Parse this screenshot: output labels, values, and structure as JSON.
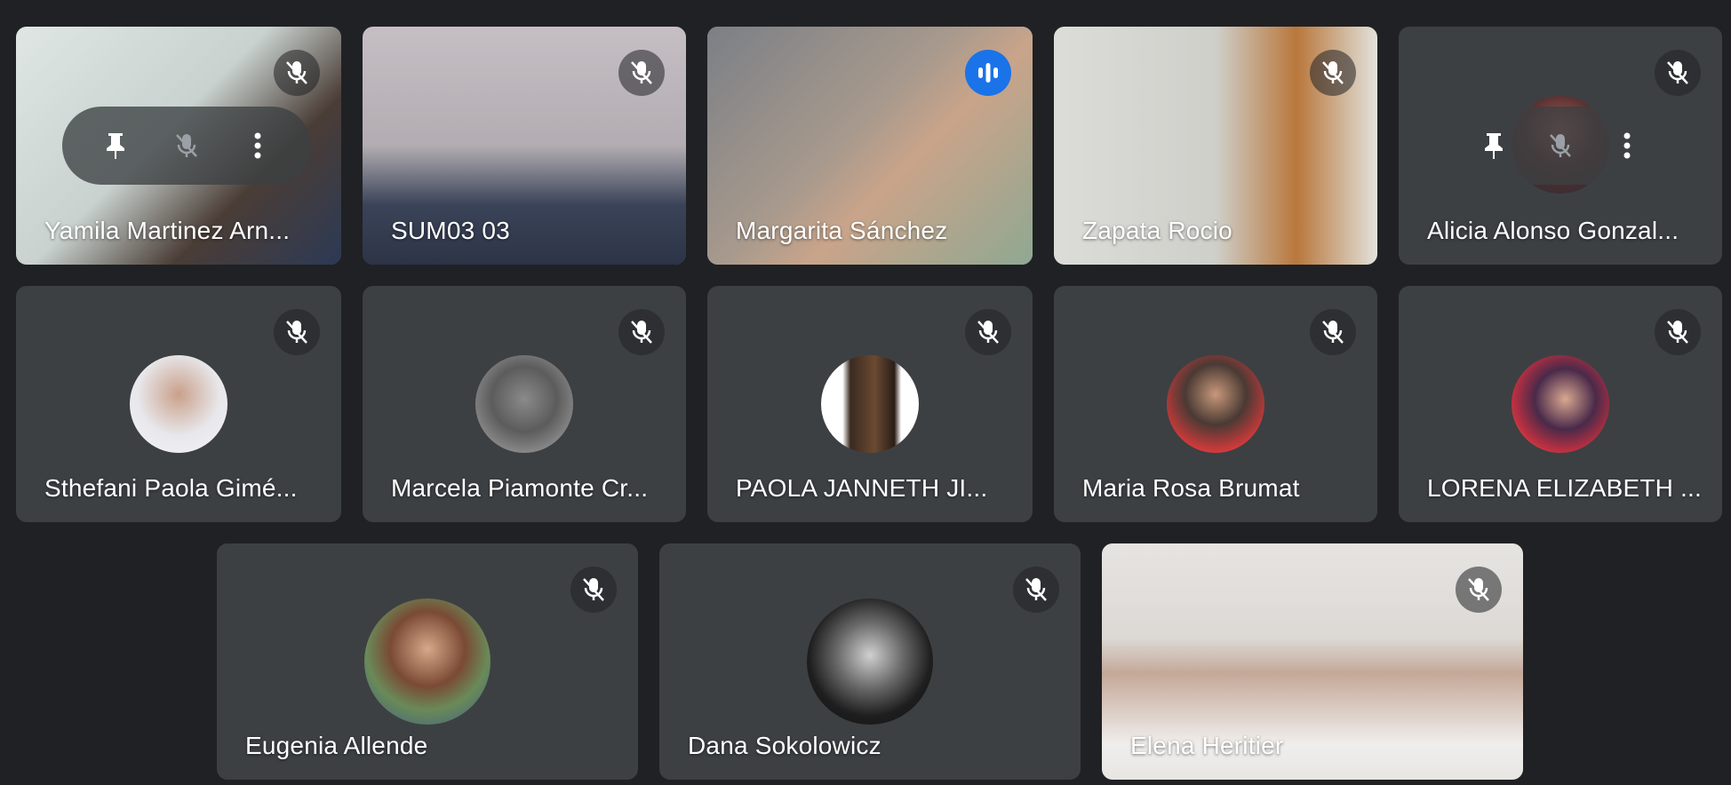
{
  "participants": [
    {
      "name": "Yamila Martinez Arn...",
      "muted": true,
      "mode": "video"
    },
    {
      "name": "SUM03 03",
      "muted": true,
      "mode": "video"
    },
    {
      "name": "Margarita Sánchez",
      "muted": false,
      "speaking": true,
      "mode": "video"
    },
    {
      "name": "Zapata Rocio",
      "muted": true,
      "mode": "video"
    },
    {
      "name": "Alicia Alonso Gonzal...",
      "muted": true,
      "mode": "avatar"
    },
    {
      "name": "Sthefani Paola Gimé...",
      "muted": true,
      "mode": "avatar"
    },
    {
      "name": "Marcela Piamonte Cr...",
      "muted": true,
      "mode": "avatar"
    },
    {
      "name": "PAOLA JANNETH JI...",
      "muted": true,
      "mode": "avatar"
    },
    {
      "name": "Maria Rosa Brumat",
      "muted": true,
      "mode": "avatar"
    },
    {
      "name": "LORENA ELIZABETH ...",
      "muted": true,
      "mode": "avatar"
    },
    {
      "name": "Eugenia Allende",
      "muted": true,
      "mode": "avatar"
    },
    {
      "name": "Dana Sokolowicz",
      "muted": true,
      "mode": "avatar"
    },
    {
      "name": "Elena Heritier",
      "muted": true,
      "mode": "video"
    }
  ],
  "icons": {
    "muted": "mic-off-icon",
    "speaking": "audio-level-icon",
    "pin": "pin-icon",
    "more": "more-vert-icon"
  },
  "colors": {
    "background": "#202124",
    "tile": "#3c4043",
    "speaking_border": "#8ab4f8",
    "speaking_badge": "#1a73e8"
  }
}
